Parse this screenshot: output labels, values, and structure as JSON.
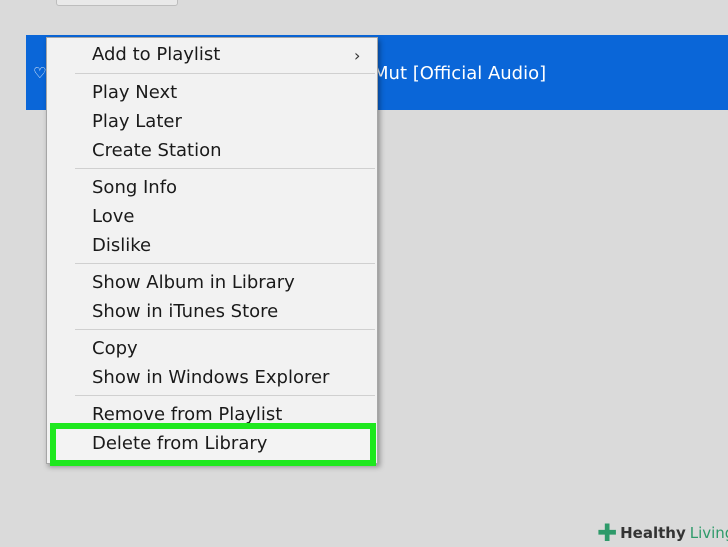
{
  "song": {
    "title_visible": "Mut [Official Audio]",
    "heart_icon": "heart-icon"
  },
  "menu": {
    "add_to_playlist": "Add to Playlist",
    "submenu_arrow": "›",
    "play_next": "Play Next",
    "play_later": "Play Later",
    "create_station": "Create Station",
    "song_info": "Song Info",
    "love": "Love",
    "dislike": "Dislike",
    "show_album": "Show Album in Library",
    "show_itunes": "Show in iTunes Store",
    "copy": "Copy",
    "show_explorer": "Show in Windows Explorer",
    "remove_playlist": "Remove from Playlist",
    "delete_library": "Delete from Library"
  },
  "highlight_color": "#1ee81e",
  "watermark": {
    "part1": "Healthy",
    "part2": "Living"
  }
}
